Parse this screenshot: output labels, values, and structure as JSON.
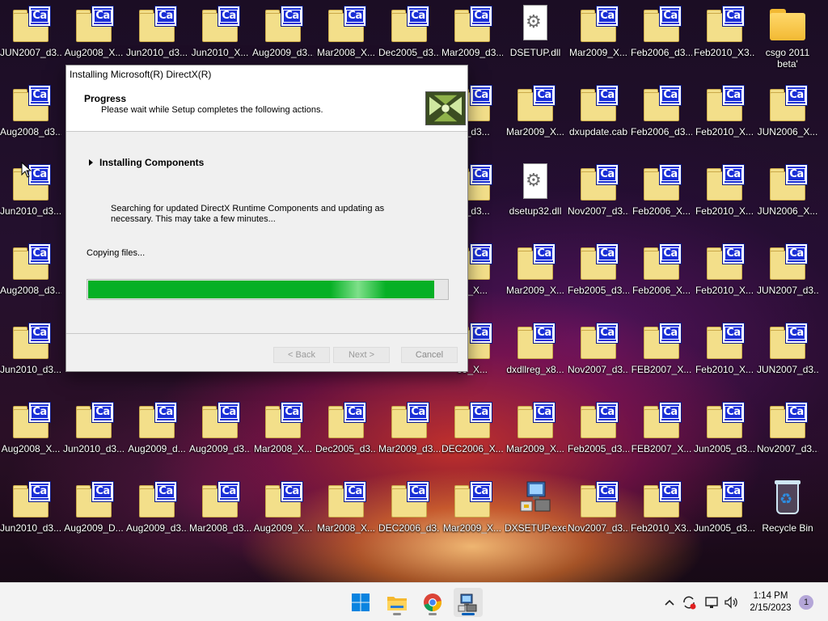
{
  "desktop": {
    "icons": [
      {
        "label": "JUN2007_d3...",
        "kind": "cab"
      },
      {
        "label": "Aug2008_X...",
        "kind": "cab"
      },
      {
        "label": "Jun2010_d3...",
        "kind": "cab"
      },
      {
        "label": "Jun2010_X...",
        "kind": "cab"
      },
      {
        "label": "Aug2009_d3...",
        "kind": "cab"
      },
      {
        "label": "Mar2008_X...",
        "kind": "cab"
      },
      {
        "label": "Dec2005_d3...",
        "kind": "cab"
      },
      {
        "label": "Mar2009_d3...",
        "kind": "cab"
      },
      {
        "label": "DSETUP.dll",
        "kind": "dll"
      },
      {
        "label": "Mar2009_X...",
        "kind": "cab"
      },
      {
        "label": "Feb2006_d3...",
        "kind": "cab"
      },
      {
        "label": "Feb2010_X3...",
        "kind": "cab"
      },
      {
        "label": "csgo 2011 beta'",
        "kind": "folder"
      },
      {
        "label": "Aug2008_d3...",
        "kind": "cab"
      },
      {
        "label": "06_d3...",
        "kind": "cab"
      },
      {
        "label": "Mar2009_X...",
        "kind": "cab"
      },
      {
        "label": "dxupdate.cab",
        "kind": "cab"
      },
      {
        "label": "Feb2006_d3...",
        "kind": "cab"
      },
      {
        "label": "Feb2010_X...",
        "kind": "cab"
      },
      {
        "label": "JUN2006_X...",
        "kind": "cab"
      },
      {
        "label": "Jun2010_d3...",
        "kind": "cab"
      },
      {
        "label": "09_d3...",
        "kind": "cab"
      },
      {
        "label": "dsetup32.dll",
        "kind": "dll"
      },
      {
        "label": "Nov2007_d3...",
        "kind": "cab"
      },
      {
        "label": "Feb2006_X...",
        "kind": "cab"
      },
      {
        "label": "Feb2010_X...",
        "kind": "cab"
      },
      {
        "label": "JUN2006_X...",
        "kind": "cab"
      },
      {
        "label": "Aug2008_d3...",
        "kind": "cab"
      },
      {
        "label": "06_X...",
        "kind": "cab"
      },
      {
        "label": "Mar2009_X...",
        "kind": "cab"
      },
      {
        "label": "Feb2005_d3...",
        "kind": "cab"
      },
      {
        "label": "Feb2006_X...",
        "kind": "cab"
      },
      {
        "label": "Feb2010_X...",
        "kind": "cab"
      },
      {
        "label": "JUN2007_d3...",
        "kind": "cab"
      },
      {
        "label": "Jun2010_d3...",
        "kind": "cab"
      },
      {
        "label": "09_X...",
        "kind": "cab"
      },
      {
        "label": "dxdllreg_x8...",
        "kind": "cab"
      },
      {
        "label": "Nov2007_d3...",
        "kind": "cab"
      },
      {
        "label": "FEB2007_X...",
        "kind": "cab"
      },
      {
        "label": "Feb2010_X...",
        "kind": "cab"
      },
      {
        "label": "JUN2007_d3...",
        "kind": "cab"
      },
      {
        "label": "Aug2008_X...",
        "kind": "cab"
      },
      {
        "label": "Jun2010_d3...",
        "kind": "cab"
      },
      {
        "label": "Aug2009_d...",
        "kind": "cab"
      },
      {
        "label": "Aug2009_d3...",
        "kind": "cab"
      },
      {
        "label": "Mar2008_X...",
        "kind": "cab"
      },
      {
        "label": "Dec2005_d3...",
        "kind": "cab"
      },
      {
        "label": "Mar2009_d3...",
        "kind": "cab"
      },
      {
        "label": "DEC2006_X...",
        "kind": "cab"
      },
      {
        "label": "Mar2009_X...",
        "kind": "cab"
      },
      {
        "label": "Feb2005_d3...",
        "kind": "cab"
      },
      {
        "label": "FEB2007_X...",
        "kind": "cab"
      },
      {
        "label": "Jun2005_d3...",
        "kind": "cab"
      },
      {
        "label": "Nov2007_d3...",
        "kind": "cab"
      },
      {
        "label": "Jun2010_d3...",
        "kind": "cab"
      },
      {
        "label": "Aug2009_D...",
        "kind": "cab"
      },
      {
        "label": "Aug2009_d3...",
        "kind": "cab"
      },
      {
        "label": "Mar2008_d3...",
        "kind": "cab"
      },
      {
        "label": "Aug2009_X...",
        "kind": "cab"
      },
      {
        "label": "Mar2008_X...",
        "kind": "cab"
      },
      {
        "label": "DEC2006_d3...",
        "kind": "cab"
      },
      {
        "label": "Mar2009_X...",
        "kind": "cab"
      },
      {
        "label": "DXSETUP.exe",
        "kind": "setup"
      },
      {
        "label": "Nov2007_d3...",
        "kind": "cab"
      },
      {
        "label": "Feb2010_X3...",
        "kind": "cab"
      },
      {
        "label": "Jun2005_d3...",
        "kind": "cab"
      },
      {
        "label": "Recycle Bin",
        "kind": "recycle"
      }
    ]
  },
  "dialog": {
    "title": "Installing Microsoft(R) DirectX(R)",
    "header_title": "Progress",
    "header_subtitle": "Please wait while Setup completes the following actions.",
    "section_heading": "Installing Components",
    "description": "Searching for updated DirectX Runtime Components and updating as necessary. This may take a few minutes...",
    "status": "Copying files...",
    "progress_fraction": 0.965,
    "buttons": {
      "back": "< Back",
      "next": "Next >",
      "cancel": "Cancel"
    }
  },
  "taskbar": {
    "apps": [
      "start",
      "file-explorer",
      "chrome",
      "dxsetup"
    ],
    "clock_time": "1:14 PM",
    "clock_date": "2/15/2023",
    "notification_count": "1"
  }
}
